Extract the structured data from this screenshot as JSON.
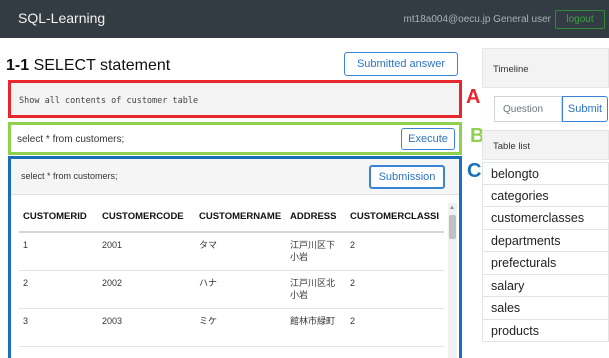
{
  "navbar": {
    "brand": "SQL-Learning",
    "user_info": "mt18a004@oecu.jp General user",
    "logout_label": "logout"
  },
  "problem": {
    "number": "1-1",
    "title": "SELECT statement",
    "submitted_answer_label": "Submitted answer",
    "question_text": "Show all contents of customer table"
  },
  "editor": {
    "query": "select * from customers;",
    "execute_label": "Execute"
  },
  "result": {
    "query": "select * from customers;",
    "submission_label": "Submission",
    "columns": [
      "CUSTOMERID",
      "CUSTOMERCODE",
      "CUSTOMERNAME",
      "ADDRESS",
      "CUSTOMERCLASSI"
    ],
    "rows": [
      [
        "1",
        "2001",
        "タマ",
        "江戸川区下小岩",
        "2"
      ],
      [
        "2",
        "2002",
        "ハナ",
        "江戸川区北小岩",
        "2"
      ],
      [
        "3",
        "2003",
        "ミケ",
        "館林市緑町",
        "2"
      ]
    ]
  },
  "annotations": {
    "a": "A",
    "b": "B",
    "c": "C"
  },
  "sidebar": {
    "timeline_label": "Timeline",
    "question_placeholder": "Question",
    "question_submit_label": "Submit",
    "table_list_label": "Table list",
    "tables": [
      "belongto",
      "categories",
      "customerclasses",
      "departments",
      "prefecturals",
      "salary",
      "sales",
      "products"
    ]
  },
  "colors": {
    "navbar": "#333b43",
    "box_a": "#e8262d",
    "box_b": "#8fd14f",
    "box_c": "#1a6fbb",
    "button_primary": "#3a84d8",
    "logout": "#3ea446"
  }
}
